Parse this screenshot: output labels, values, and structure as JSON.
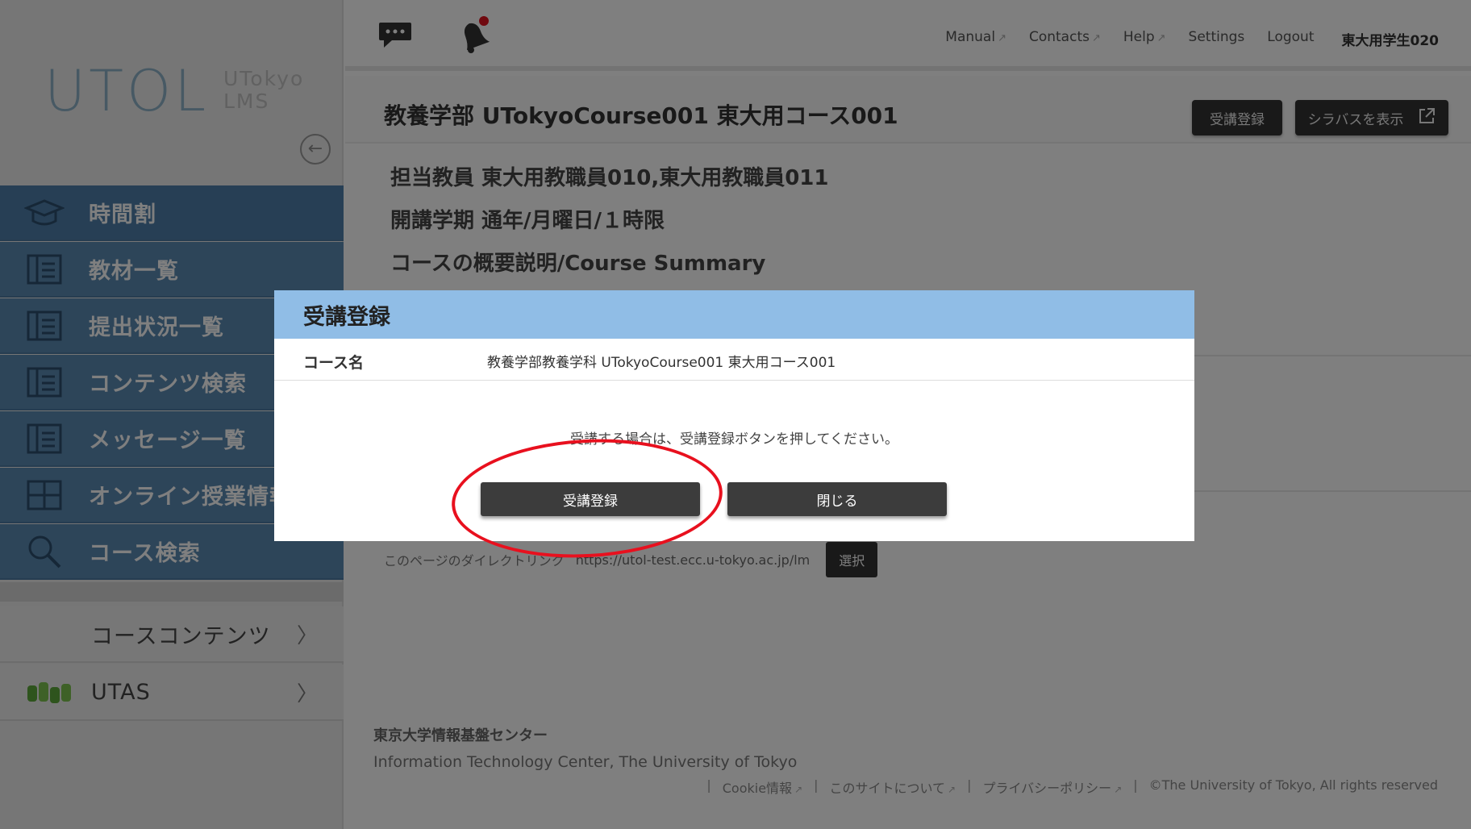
{
  "app": {
    "logo_main": "UTOL",
    "logo_sub_1": "UTokyo",
    "logo_sub_2": "LMS"
  },
  "sidebar": {
    "items": [
      {
        "label": "時間割",
        "icon": "mortarboard-icon"
      },
      {
        "label": "教材一覧",
        "icon": "book-icon"
      },
      {
        "label": "提出状況一覧",
        "icon": "book-icon"
      },
      {
        "label": "コンテンツ検索",
        "icon": "book-icon"
      },
      {
        "label": "メッセージ一覧",
        "icon": "book-icon"
      },
      {
        "label": "オンライン授業情報",
        "icon": "grid-icon"
      },
      {
        "label": "コース検索",
        "icon": "search-icon"
      }
    ],
    "course_contents": "コースコンテンツ",
    "utas": "UTAS",
    "chevron": "〉"
  },
  "topbar": {
    "manual": "Manual",
    "contacts": "Contacts",
    "help": "Help",
    "settings": "Settings",
    "logout": "Logout",
    "user": "東大用学生020"
  },
  "course": {
    "title": "教養学部 UTokyoCourse001 東大用コース001",
    "enroll_button": "受講登録",
    "syllabus_button": "シラバスを表示",
    "instructor": "担当教員 東大用教職員010,東大用教職員011",
    "term": "開講学期 通年/月曜日/１時限",
    "summary_heading": "コースの概要説明/Course Summary"
  },
  "direct_link": {
    "label": "このページのダイレクトリンク",
    "url": "https://utol-test.ecc.u-tokyo.ac.jp/lm",
    "select_button": "選択"
  },
  "footer": {
    "org_ja": "東京大学情報基盤センター",
    "org_en": "Information Technology Center, The University of Tokyo",
    "cookie": "Cookie情報",
    "about": "このサイトについて",
    "privacy": "プライバシーポリシー",
    "copyright": "©The University of Tokyo, All rights reserved",
    "separator": "|"
  },
  "modal": {
    "title": "受講登録",
    "course_label": "コース名",
    "course_value": "教養学部教養学科 UTokyoCourse001 東大用コース001",
    "message": "受講する場合は、受講登録ボタンを押してください。",
    "enroll_button": "受講登録",
    "close_button": "閉じる"
  },
  "colors": {
    "modal_header": "#90bde6",
    "sidebar_nav": "#5b8ab3",
    "highlight": "#e8101e",
    "button_dark": "#3c3c3c"
  }
}
